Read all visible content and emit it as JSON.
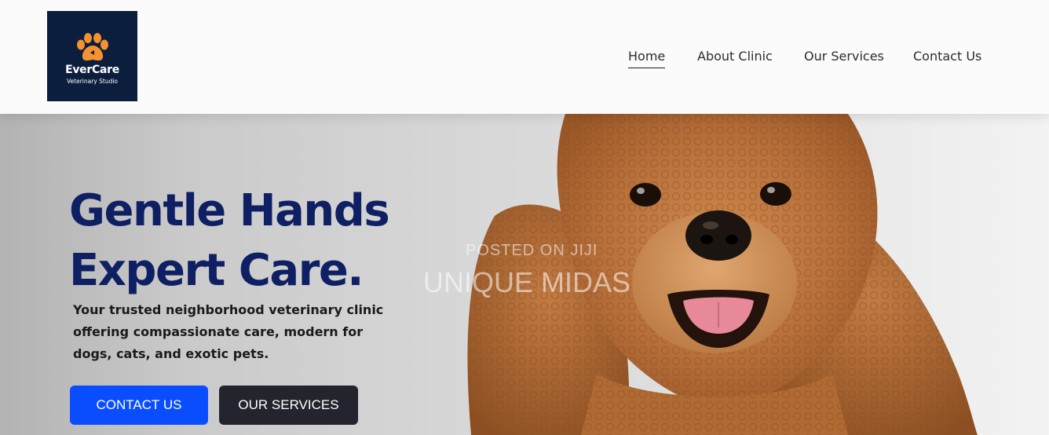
{
  "brand": {
    "icon": "paw-icon",
    "name": "EverCare",
    "tagline": "Veterinary Studio",
    "colors": {
      "logo_bg": "#0c1e3d",
      "paw": "#f5912e"
    }
  },
  "nav": {
    "items": [
      {
        "label": "Home",
        "active": true
      },
      {
        "label": "About Clinic",
        "active": false
      },
      {
        "label": "Our Services",
        "active": false
      },
      {
        "label": "Contact Us",
        "active": false
      }
    ]
  },
  "hero": {
    "title_line1": "Gentle Hands",
    "title_line2": "Expert Care.",
    "description": "Your trusted neighborhood veterinary clinic offering compassionate care, modern for dogs, cats, and exotic pets.",
    "buttons": {
      "contact": "CONTACT US",
      "services": "OUR SERVICES"
    },
    "image": "poodle-dog-photo",
    "colors": {
      "title": "#0f1f63",
      "primary_button": "#0a4dff",
      "secondary_button": "#23242d"
    }
  },
  "watermark": {
    "line1": "POSTED ON JIJI",
    "line2": "UNIQUE MIDAS"
  }
}
